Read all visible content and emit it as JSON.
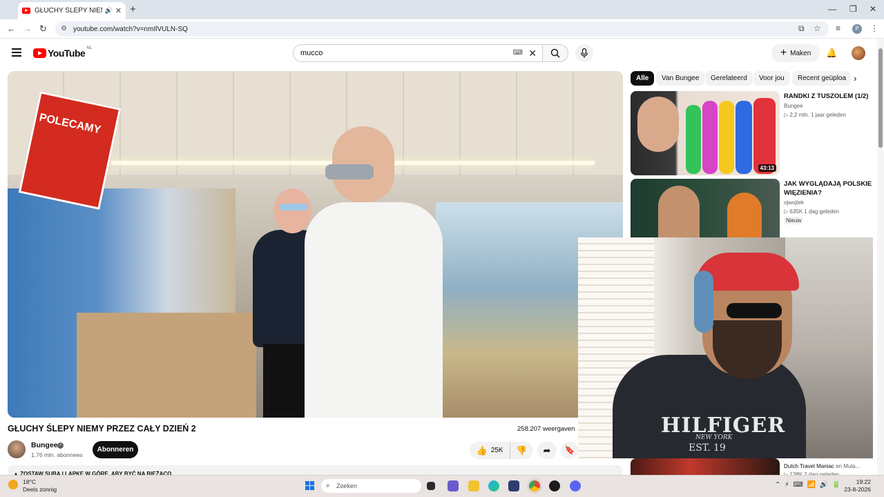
{
  "browser": {
    "tab_title": "GŁUCHY ŚLEPY NIEMY PRZE",
    "url": "youtube.com/watch?v=nmIlVULN-SQ"
  },
  "youtube": {
    "logo_text": "YouTube",
    "logo_country": "NL",
    "search_value": "mucco",
    "make_label": "Maken"
  },
  "video": {
    "sign_text": "POLECAMY",
    "title": "GŁUCHY ŚLEPY NIEMY PRZEZ CAŁY DZIEŃ 2",
    "views": "258.207 weergaven",
    "channel": "Bungee",
    "subscribers": "1,76 mln. abonnees",
    "subscribe_label": "Abonneren",
    "likes": "25K",
    "description": "▲ ZOSTAW SUBA I LAPKE W GÓRE, ABY BYĆ NA BIEŻĄCO"
  },
  "webcam": {
    "shirt_brand": "HILFIGER",
    "shirt_sub": "NEW YORK",
    "shirt_est": "EST. 19"
  },
  "sidebar": {
    "chips": [
      "Alle",
      "Van Bungee",
      "Gerelateerd",
      "Voor jou",
      "Recent geüploa"
    ],
    "videos": [
      {
        "title": "RANDKI Z TUSZOLEM (1/2)",
        "channel": "Bungee",
        "meta": "▷ 2,2 mln.  1 jaar geleden",
        "duration": "43:13"
      },
      {
        "title": "JAK WYGLĄDAJĄ POLSKIE WIĘZIENIA?",
        "channel": "ojwojtek",
        "meta": "▷ 635K  1 dag geleden",
        "badge": "Nieuw"
      },
      {
        "channel": "Dutch Travel Maniac",
        "channel_extra": "en Mula...",
        "meta": "▷ 138K  2 dag geleden"
      }
    ]
  },
  "taskbar": {
    "temperature": "18°C",
    "weather": "Deels zonnig",
    "search_placeholder": "Zoeken",
    "time": "19:22",
    "date": "23-8-2026"
  },
  "colors": {
    "youtube_red": "#ff0000",
    "tab_bar": "#dde3ea"
  }
}
